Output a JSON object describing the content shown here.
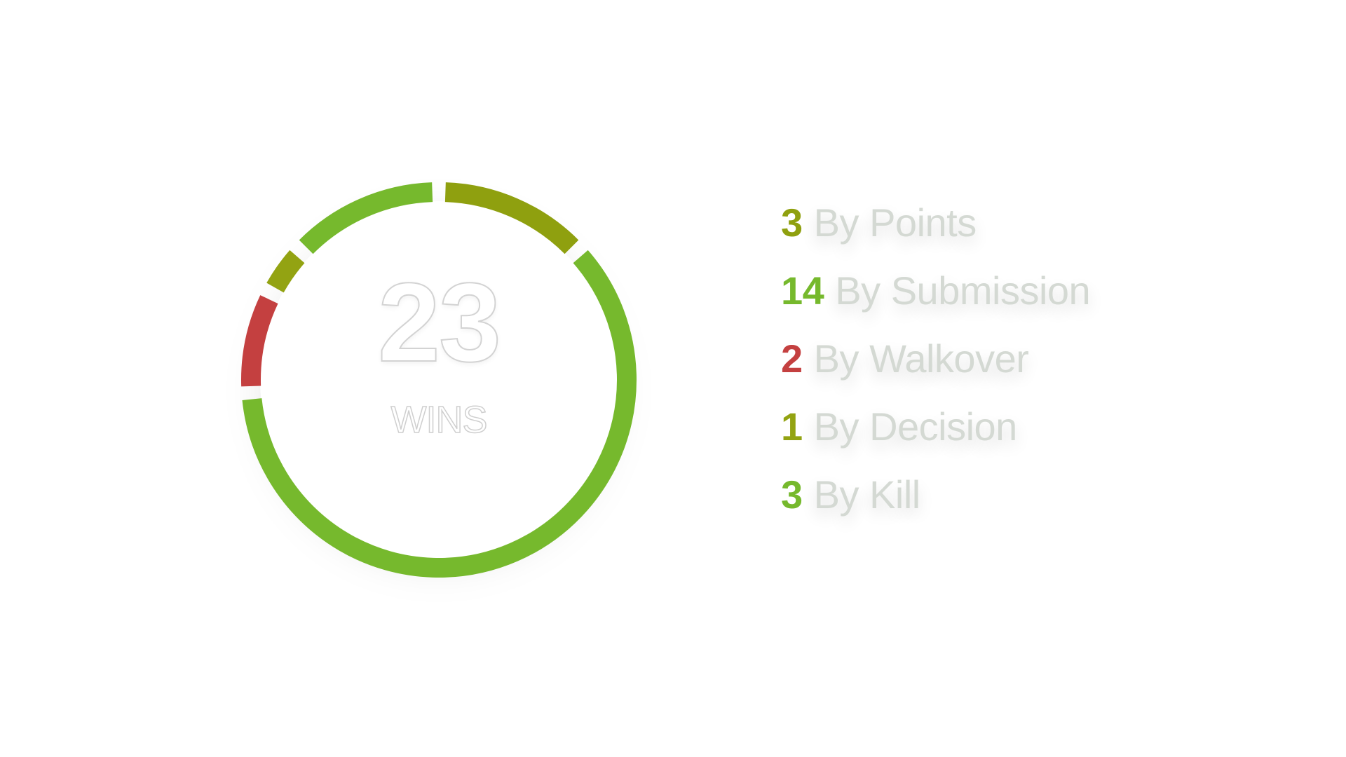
{
  "chart_data": {
    "type": "pie",
    "variant": "donut",
    "title": "",
    "center": {
      "total": "23",
      "label": "WINS"
    },
    "slices": [
      {
        "label": "By Points",
        "value": 3,
        "color": "#8fa00f"
      },
      {
        "label": "By Submission",
        "value": 14,
        "color": "#76b92d"
      },
      {
        "label": "By Walkover",
        "value": 2,
        "color": "#c44040"
      },
      {
        "label": "By Decision",
        "value": 1,
        "color": "#93a312"
      },
      {
        "label": "By Kill",
        "value": 3,
        "color": "#76b92d"
      }
    ],
    "legend_placement": "right"
  }
}
